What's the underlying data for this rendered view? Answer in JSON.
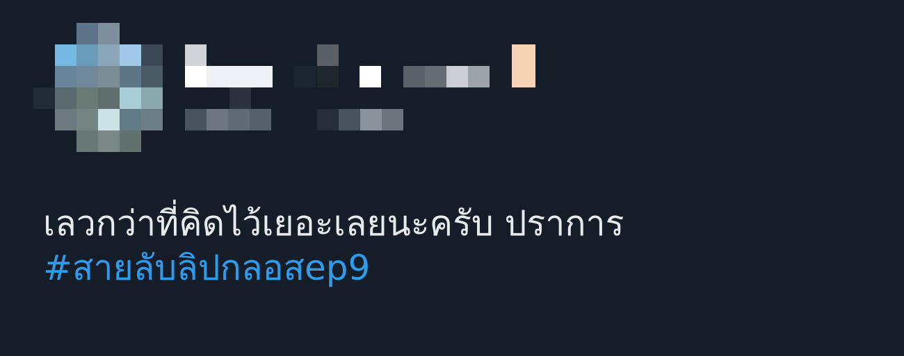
{
  "tweet": {
    "avatar_icon": "pixelated-avatar",
    "display_name": "",
    "handle": "",
    "text": "เลวกว่าที่คิดไว้เยอะเลยนะครับ ปราการ",
    "hashtag": "#สายลับลิปกลอสep9"
  },
  "colors": {
    "background": "#151d28",
    "text": "#e7ebee",
    "link": "#2d9ced"
  }
}
